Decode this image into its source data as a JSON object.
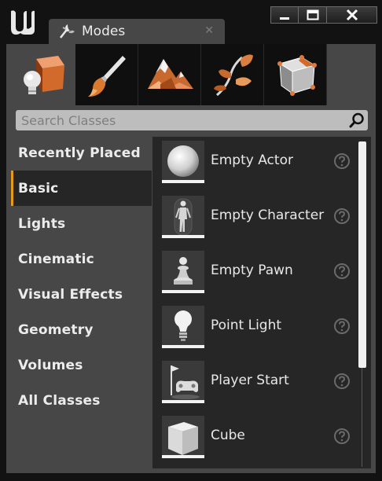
{
  "window": {
    "tab_title": "Modes",
    "tab_close": "✕",
    "controls": {
      "minimize": "minimize",
      "maximize": "maximize",
      "close": "close"
    }
  },
  "modes": [
    {
      "name": "place",
      "icon": "place-mode-icon",
      "active": true
    },
    {
      "name": "paint",
      "icon": "paint-mode-icon",
      "active": false
    },
    {
      "name": "landscape",
      "icon": "landscape-mode-icon",
      "active": false
    },
    {
      "name": "foliage",
      "icon": "foliage-mode-icon",
      "active": false
    },
    {
      "name": "geometry",
      "icon": "geometry-edit-mode-icon",
      "active": false
    }
  ],
  "search": {
    "placeholder": "Search Classes",
    "value": ""
  },
  "categories": [
    {
      "label": "Recently Placed",
      "active": false
    },
    {
      "label": "Basic",
      "active": true
    },
    {
      "label": "Lights",
      "active": false
    },
    {
      "label": "Cinematic",
      "active": false
    },
    {
      "label": "Visual Effects",
      "active": false
    },
    {
      "label": "Geometry",
      "active": false
    },
    {
      "label": "Volumes",
      "active": false
    },
    {
      "label": "All Classes",
      "active": false
    }
  ],
  "items": [
    {
      "label": "Empty Actor",
      "icon": "sphere-icon"
    },
    {
      "label": "Empty Character",
      "icon": "mannequin-icon"
    },
    {
      "label": "Empty Pawn",
      "icon": "pawn-icon"
    },
    {
      "label": "Point Light",
      "icon": "light-bulb-icon"
    },
    {
      "label": "Player Start",
      "icon": "player-start-icon"
    },
    {
      "label": "Cube",
      "icon": "cube-icon"
    }
  ],
  "colors": {
    "accent": "#e89a14",
    "panel": "#474747",
    "list_bg": "#262626",
    "window_bg": "#121212"
  }
}
